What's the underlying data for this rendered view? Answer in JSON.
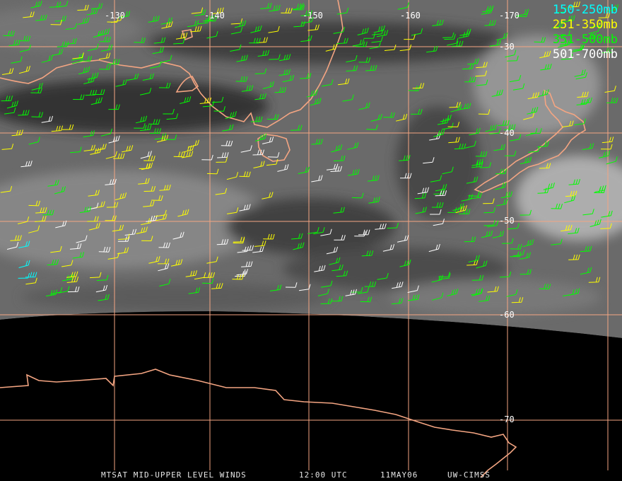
{
  "map": {
    "longitude_labels": [
      "-130",
      "-140",
      "-150",
      "-160",
      "-170"
    ],
    "latitude_labels": [
      "-30",
      "-40",
      "-50",
      "-60",
      "-70"
    ],
    "colors": {
      "coastline": "#f4a582",
      "grid": "#f4a582",
      "space": "#000000",
      "cloud_bright": "#d0d0d0",
      "cloud_dark": "#3a3a3a"
    }
  },
  "legend": {
    "items": [
      {
        "label": "150-250mb",
        "color": "#00ffff"
      },
      {
        "label": "251-350mb",
        "color": "#ffff00"
      },
      {
        "label": "351-500mb",
        "color": "#00ff00"
      },
      {
        "label": "501-700mb",
        "color": "#ffffff"
      }
    ]
  },
  "footer": {
    "title": "MTSAT MID-UPPER LEVEL WINDS",
    "time": "12:00 UTC",
    "date": "11MAY06",
    "source": "UW-CIMSS"
  }
}
